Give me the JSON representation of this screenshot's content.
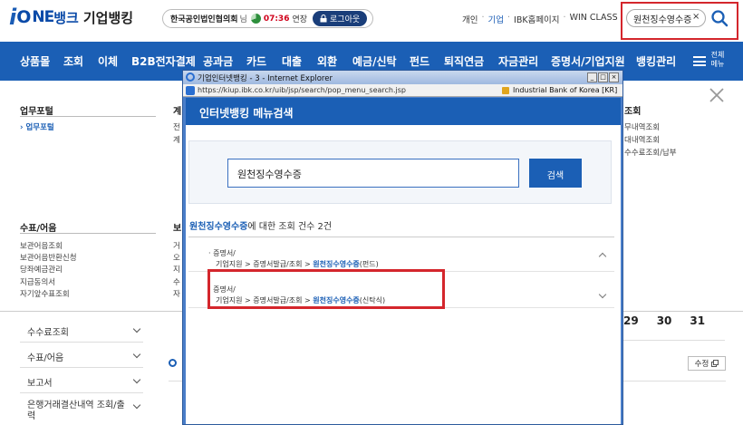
{
  "header": {
    "logo": {
      "i": "i",
      "one_o": "O",
      "one_ne": "NE",
      "bank": "뱅크",
      "corp": "기업뱅킹"
    },
    "session": {
      "org_name": "한국공인법인협의회",
      "suffix": "님",
      "time": "07:36",
      "extend": "연장",
      "logout": "로그아웃"
    },
    "toplinks": {
      "personal": "개인",
      "corp": "기업",
      "ibk_home": "IBK홈페이지",
      "win_class": "WIN CLASS",
      "sep": "·"
    },
    "search": {
      "value": "원천징수영수증",
      "clear": "×"
    }
  },
  "nav": {
    "items": [
      "상품몰",
      "조회",
      "이체",
      "B2B전자결제",
      "공과금",
      "카드",
      "대출",
      "외환",
      "예금/신탁",
      "펀드",
      "퇴직연금",
      "자금관리",
      "증명서/기업지원",
      "뱅킹관리"
    ],
    "all_menu": "전체메뉴"
  },
  "mega_menu": {
    "col1_head": "업무포털",
    "col1_items": [
      "업무포털"
    ],
    "col2_head": "계",
    "col2_items": [
      "전",
      "계"
    ],
    "col3_head": "조회",
    "col3_items": [
      "무내역조회",
      "대내역조회",
      "수수료조회/납부"
    ],
    "col4_head": "수표/어음",
    "col4_items": [
      "보관어음조회",
      "보관어음반환신청",
      "당좌예금관리",
      "지급동의서",
      "자기앞수표조회"
    ],
    "col5_head": "보",
    "col5_items": [
      "거",
      "오",
      "지",
      "수",
      "자"
    ]
  },
  "left_menu": [
    "수수료조회",
    "수표/어음",
    "보고서",
    "은행거래결산내역 조회/출력"
  ],
  "calendar": {
    "days": [
      "29",
      "30",
      "31"
    ],
    "edit": "수정"
  },
  "popup": {
    "title": "기업인터넷뱅킹 - 3 - Internet Explorer",
    "buttons": {
      "min": "_",
      "max": "□",
      "close": "×"
    },
    "url": "https://kiup.ibk.co.kr/uib/jsp/search/pop_menu_search.jsp",
    "site": "Industrial Bank of Korea [KR]",
    "heading": "인터넷뱅킹 메뉴검색",
    "input_value": "원천징수영수증",
    "search_button": "검색",
    "summary_keyword": "원천징수영수증",
    "summary_rest": "에 대한 조회 건수 2건",
    "results": [
      {
        "cat": "증명서/",
        "p1": "기업지원",
        "p2": "증명서발급/조회",
        "hl": "원천징수영수증",
        "tag": "(펀드)"
      },
      {
        "cat": "증명서/",
        "p1": "기업지원",
        "p2": "증명서발급/조회",
        "hl": "원천징수영수증",
        "tag": "(신탁식)"
      }
    ],
    "sep": ">"
  }
}
